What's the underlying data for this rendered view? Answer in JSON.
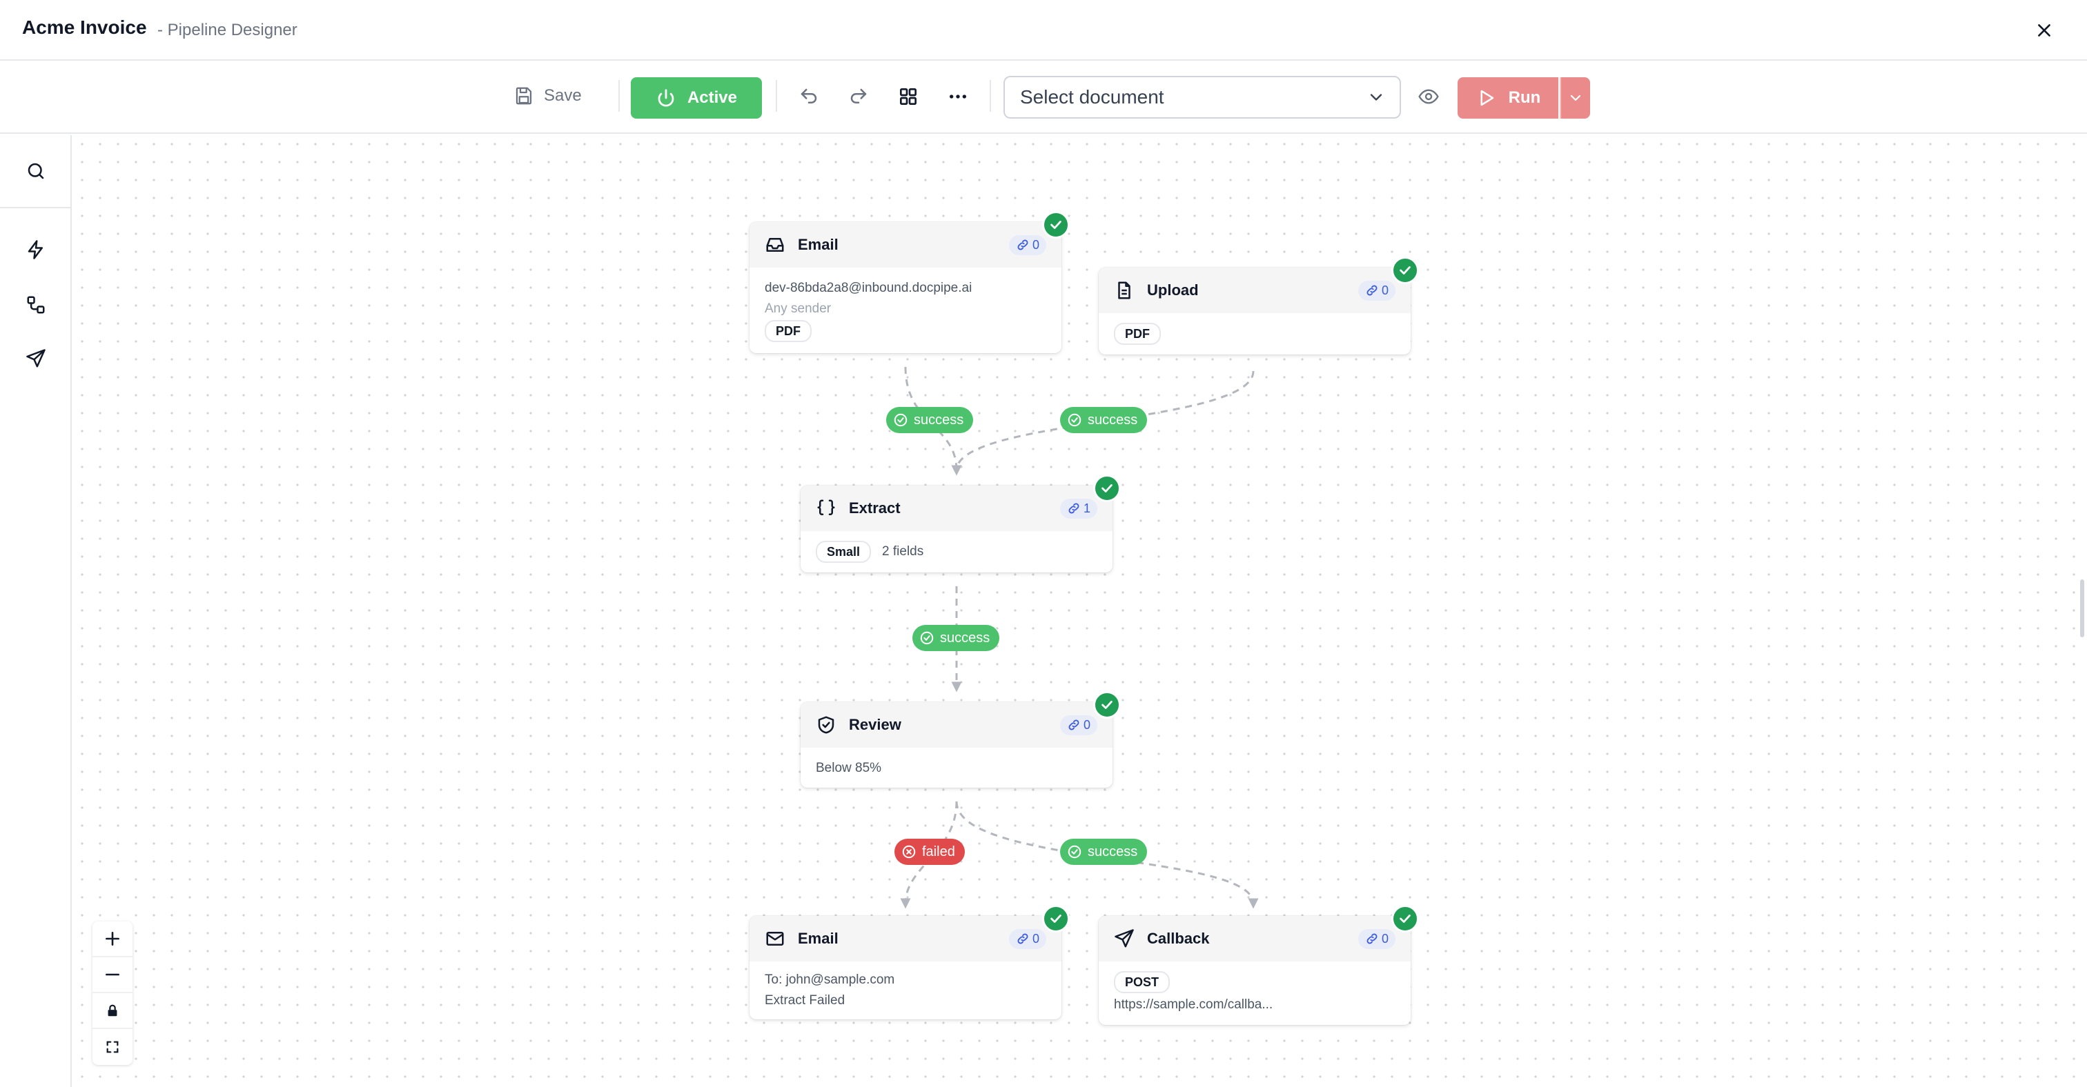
{
  "header": {
    "title": "Acme Invoice",
    "subtitle": "- Pipeline Designer"
  },
  "toolbar": {
    "save_label": "Save",
    "active_label": "Active",
    "document_placeholder": "Select document",
    "run_label": "Run"
  },
  "nodes": {
    "email_trigger": {
      "title": "Email",
      "links": "0",
      "address": "dev-86bda2a8@inbound.docpipe.ai",
      "sender": "Any sender",
      "tag": "PDF"
    },
    "upload": {
      "title": "Upload",
      "links": "0",
      "tag": "PDF"
    },
    "extract": {
      "title": "Extract",
      "links": "1",
      "tag": "Small",
      "fields": "2 fields"
    },
    "review": {
      "title": "Review",
      "links": "0",
      "threshold": "Below 85%"
    },
    "email_action": {
      "title": "Email",
      "links": "0",
      "to": "To: john@sample.com",
      "subject": "Extract Failed"
    },
    "callback": {
      "title": "Callback",
      "links": "0",
      "method": "POST",
      "url": "https://sample.com/callba..."
    }
  },
  "edges": {
    "email_to_extract": "success",
    "upload_to_extract": "success",
    "extract_to_review": "success",
    "review_to_email": "failed",
    "review_to_callback": "success"
  },
  "colors": {
    "active_green": "#4cc26c",
    "success_green": "#4cc26c",
    "failed_red": "#e04a4a",
    "check_green": "#1f9d55",
    "run_red": "#ea8a8a",
    "link_blue": "#3b5bdb"
  },
  "icons": {
    "sidebar": [
      "search-icon",
      "lightning-icon",
      "nodes-icon",
      "send-icon"
    ],
    "zoom": [
      "plus-icon",
      "minus-icon",
      "lock-icon",
      "fit-view-icon"
    ]
  }
}
